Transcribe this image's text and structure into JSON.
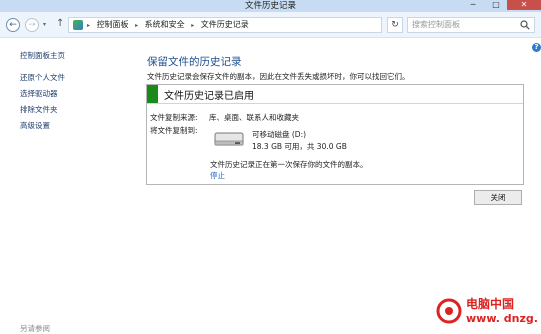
{
  "window": {
    "title": "文件历史记录",
    "min_glyph": "─",
    "max_glyph": "□",
    "close_glyph": "✕"
  },
  "nav": {
    "back_glyph": "←",
    "forward_glyph": "→",
    "recent_glyph": "▾",
    "up_glyph": "↑",
    "breadcrumb": [
      "控制面板",
      "系统和安全",
      "文件历史记录"
    ],
    "separator": "▸",
    "dropdown_glyph": "▾",
    "refresh_glyph": "↻",
    "search_placeholder": "搜索控制面板"
  },
  "help_glyph": "?",
  "sidebar": {
    "home": "控制面板主页",
    "items": [
      "还原个人文件",
      "选择驱动器",
      "排除文件夹",
      "高级设置"
    ],
    "see_also": "另请参阅"
  },
  "main": {
    "heading": "保留文件的历史记录",
    "description": "文件历史记录会保存文件的副本，因此在文件丢失或损坏时，你可以找回它们。",
    "status": {
      "text": "文件历史记录已启用",
      "color": "#1a8a1a"
    },
    "copy_from_label": "文件复制来源:",
    "copy_from_value": "库、桌面、联系人和收藏夹",
    "copy_to_label": "将文件复制到:",
    "drive_name": "可移动磁盘 (D:)",
    "drive_space": "18.3 GB 可用，共 30.0 GB",
    "progress_message": "文件历史记录正在第一次保存你的文件的副本。",
    "stop_link": "停止",
    "close_button": "关闭"
  },
  "watermark": {
    "name": "电脑中国",
    "url": "www. dnzg. cn"
  },
  "colors": {
    "accent_link": "#1c64c8",
    "heading": "#1e4f8c",
    "close_button_bg": "#c7504a",
    "watermark": "#dd2222"
  }
}
